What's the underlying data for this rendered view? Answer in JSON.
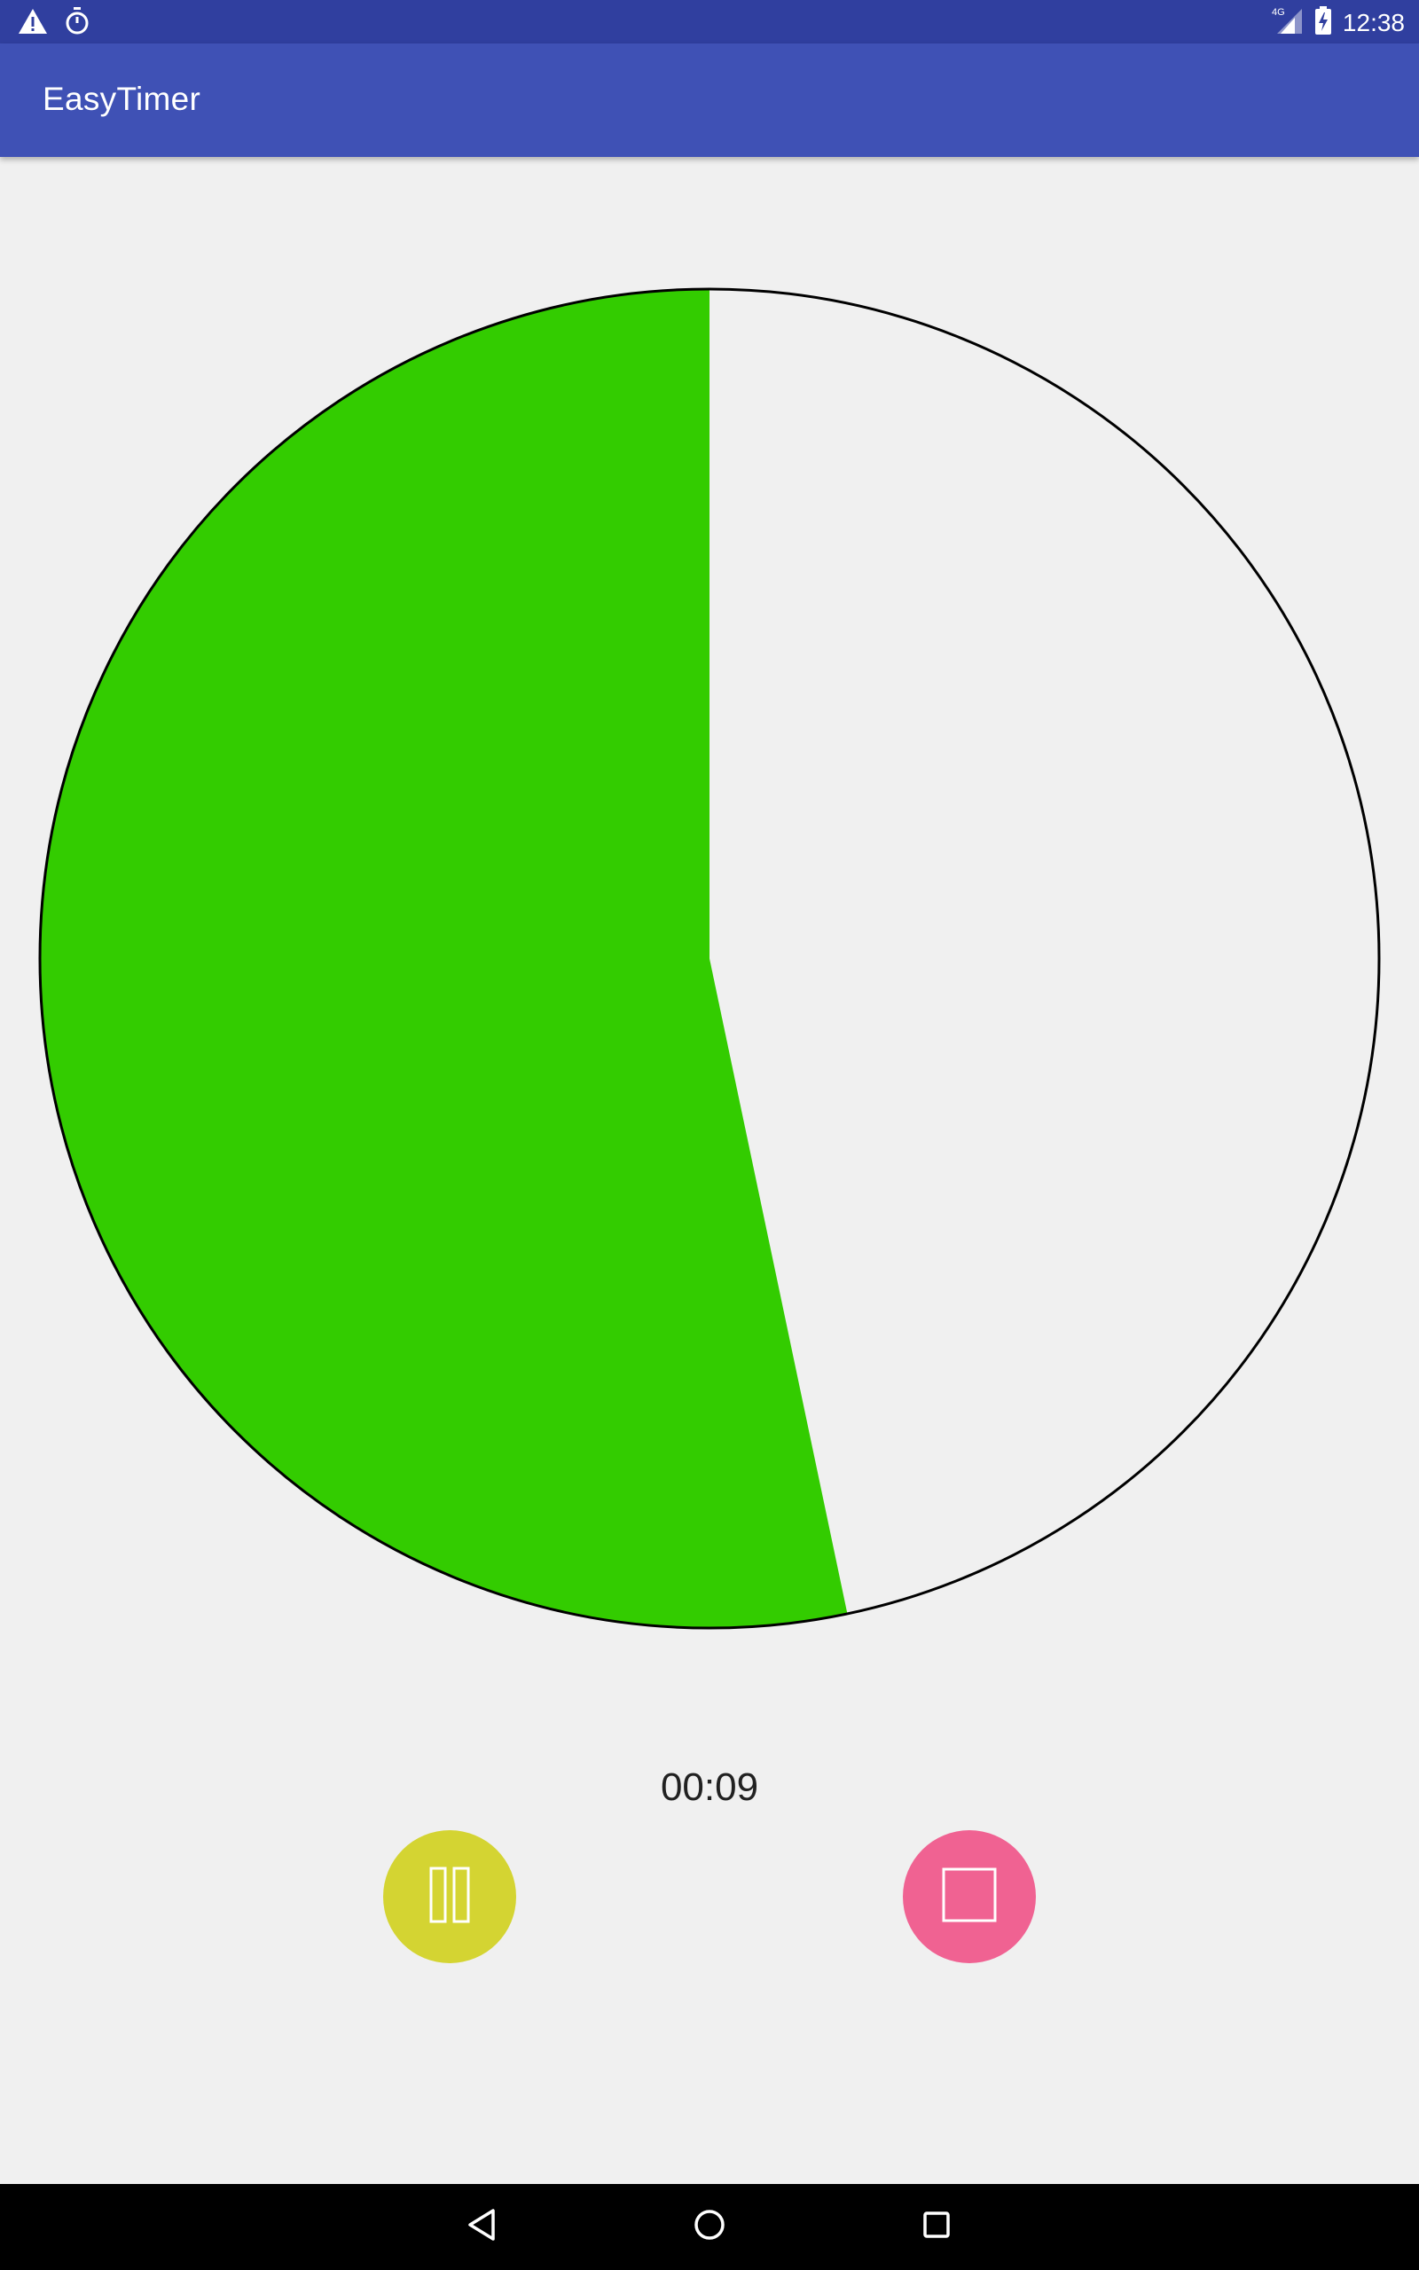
{
  "status_bar": {
    "network": "4G",
    "time": "12:38",
    "icons": [
      "warning-icon",
      "stopwatch-icon",
      "signal-icon",
      "battery-charging-icon"
    ]
  },
  "app_bar": {
    "title": "EasyTimer"
  },
  "timer": {
    "elapsed_fraction": 0.533,
    "fill_color": "#33cc00",
    "empty_color": "#f0f0f0",
    "outline_color": "#000000",
    "time_display": "00:09"
  },
  "controls": {
    "pause": {
      "icon": "pause-icon",
      "color": "#d4d432"
    },
    "stop": {
      "icon": "stop-icon",
      "color": "#f06292"
    }
  },
  "nav_bar": {
    "icons": [
      "back-icon",
      "home-icon",
      "recents-icon"
    ]
  },
  "colors": {
    "status_bar": "#303f9f",
    "app_bar": "#3f51b5",
    "background": "#f0f0f0"
  }
}
